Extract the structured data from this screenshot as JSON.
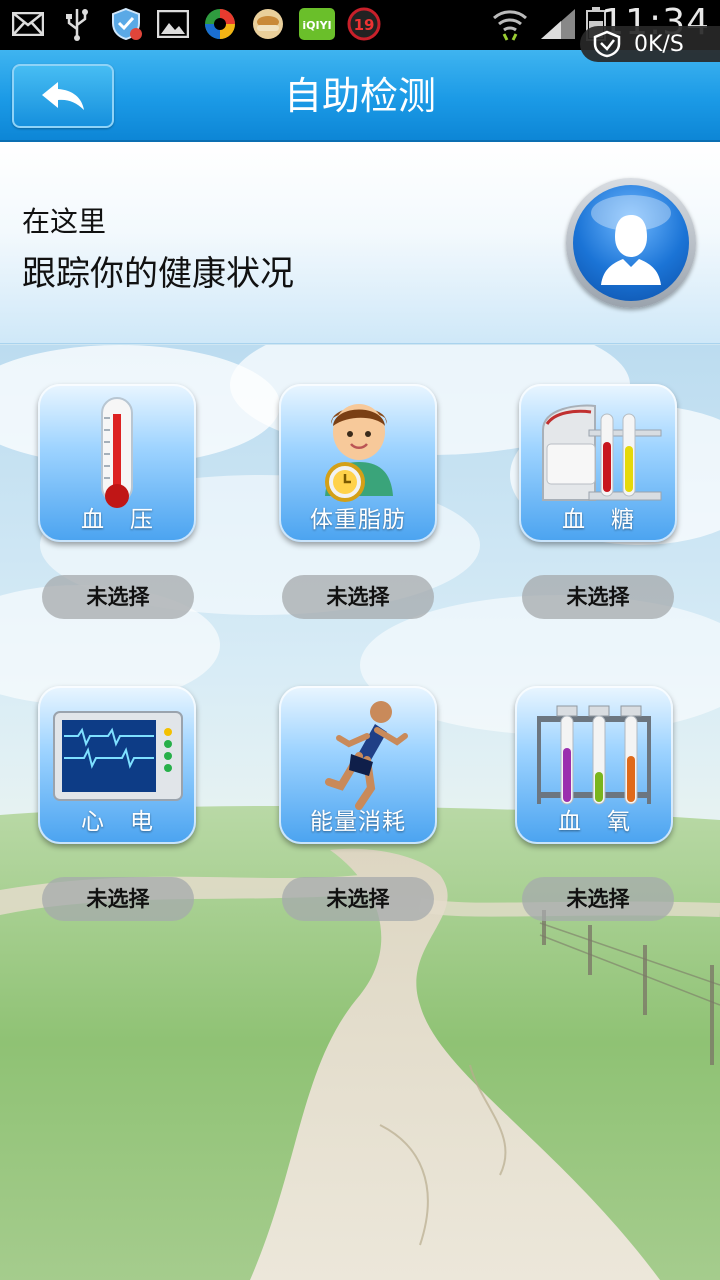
{
  "status_bar": {
    "time": "11:34",
    "net_speed": "0K/S",
    "icons": [
      "mail-icon",
      "usb-icon",
      "shield-icon",
      "image-icon",
      "app-icon",
      "food-app-icon",
      "iqiyi-icon",
      "badge-19-icon",
      "wifi-icon",
      "signal-icon",
      "battery-icon"
    ],
    "iqiyi_text": "iQIYI",
    "badge_number": "19"
  },
  "title_bar": {
    "title": "自助检测"
  },
  "header": {
    "line1": "在这里",
    "line2": "跟踪你的健康状况"
  },
  "tiles": [
    {
      "label": "血压",
      "status": "未选择"
    },
    {
      "label": "体重脂肪",
      "status": "未选择"
    },
    {
      "label": "血糖",
      "status": "未选择"
    },
    {
      "label": "心电",
      "status": "未选择"
    },
    {
      "label": "能量消耗",
      "status": "未选择"
    },
    {
      "label": "血氧",
      "status": "未选择"
    }
  ],
  "colors": {
    "title_bar": "#1b9ae6",
    "status_pill": "#a5aaac",
    "tile_gradient_bottom": "#4aa3f0"
  }
}
